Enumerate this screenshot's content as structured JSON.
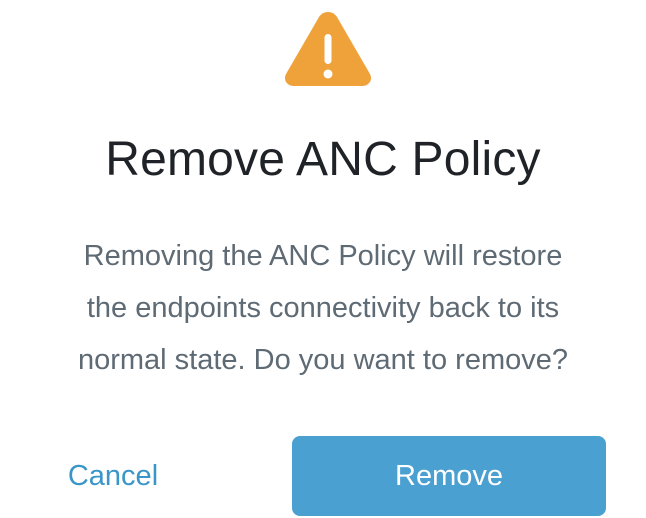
{
  "dialog": {
    "icon": "warning-icon",
    "title": "Remove ANC Policy",
    "message_lines": [
      "Removing the ANC Policy will restore",
      "the endpoints connectivity back to its",
      "normal state. Do you want to remove?"
    ],
    "cancel_label": "Cancel",
    "remove_label": "Remove"
  },
  "colors": {
    "warning": "#F0A23A",
    "title": "#1F2327",
    "message": "#5E6A74",
    "link": "#3A96C8",
    "primary": "#4AA0D1"
  }
}
